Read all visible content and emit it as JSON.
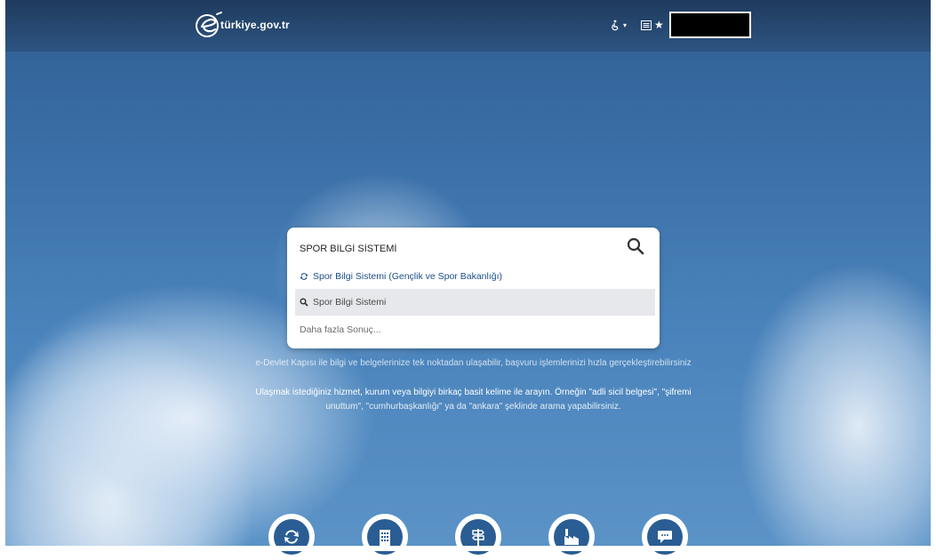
{
  "header": {
    "logo_text": "türkiye.gov.tr",
    "accessibility_icon": "accessibility-icon",
    "bookmark_icon": "bookmark-star-icon"
  },
  "search": {
    "value": "SPOR BİLGİ SİSTEMİ",
    "button_icon": "search-icon",
    "suggestions": [
      {
        "icon": "refresh-icon",
        "label": "Spor Bilgi Sistemi (Gençlik ve Spor Bakanlığı)"
      },
      {
        "icon": "search-icon",
        "label": "Spor Bilgi Sistemi"
      },
      {
        "icon": "",
        "label": "Daha fazla Sonuç..."
      }
    ]
  },
  "intro": {
    "line1": "e-Devlet Kapısı ile bilgi ve belgelerinize tek noktadan ulaşabilir, başvuru işlemlerinizi hızla gerçekleştirebilirsiniz",
    "line2": "Ulaşmak istediğiniz hizmet, kurum veya bilgiyi birkaç basit kelime ile arayın. Örneğin \"adli sicil belgesi\", \"şifremi",
    "line3": "unuttum\", \"cumhurbaşkanlığı\" ya da \"ankara\" şeklinde arama yapabilirsiniz."
  },
  "quick_links": [
    {
      "icon": "refresh-icon"
    },
    {
      "icon": "building-icon"
    },
    {
      "icon": "signpost-icon"
    },
    {
      "icon": "factory-icon"
    },
    {
      "icon": "chat-icon"
    }
  ],
  "colors": {
    "brand_blue": "#2a5d93",
    "link_blue": "#1c4f86",
    "hover_gray": "#e6e8eb"
  }
}
